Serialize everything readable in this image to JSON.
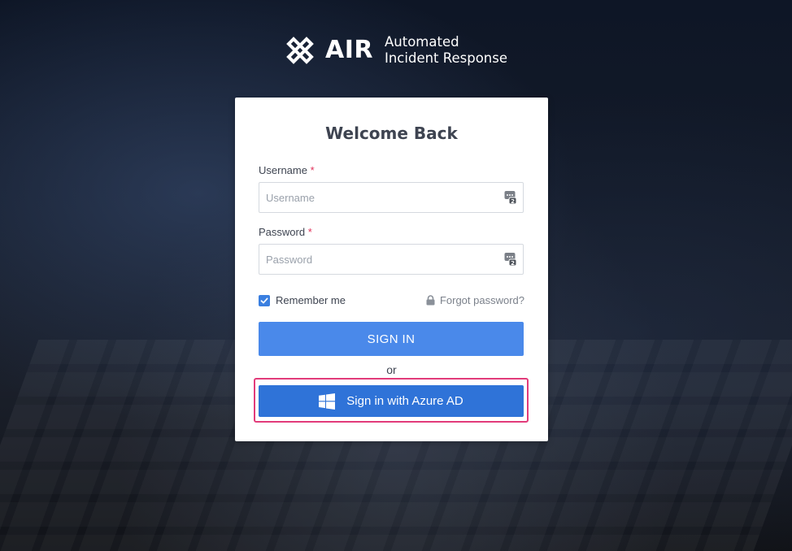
{
  "brand": {
    "name": "AIR",
    "tagline_line1": "Automated",
    "tagline_line2": "Incident Response"
  },
  "login": {
    "title": "Welcome Back",
    "username": {
      "label": "Username",
      "required_mark": "*",
      "placeholder": "Username",
      "value": ""
    },
    "password": {
      "label": "Password",
      "required_mark": "*",
      "placeholder": "Password",
      "value": ""
    },
    "remember_me": {
      "label": "Remember me",
      "checked": true
    },
    "forgot_password": "Forgot password?",
    "sign_in_button": "SIGN IN",
    "or_divider": "or",
    "azure_button": "Sign in with Azure AD"
  },
  "icons": {
    "brand_logo": "air-logo-icon",
    "field_password_manager": "password-manager-icon",
    "checkbox_check": "checkmark-icon",
    "forgot_lock": "lock-icon",
    "azure": "windows-logo-icon"
  },
  "colors": {
    "primary_button": "#4a89ea",
    "azure_button": "#2f73d8",
    "highlight_border": "#e23b7a",
    "required": "#e0315a",
    "title_text": "#3e4451"
  }
}
